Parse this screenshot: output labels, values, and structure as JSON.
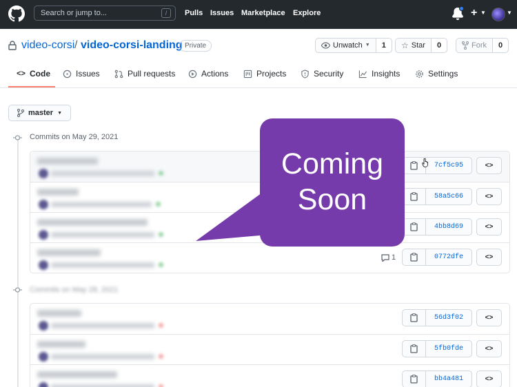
{
  "header": {
    "search_placeholder": "Search or jump to...",
    "search_shortcut": "/",
    "nav": [
      "Pulls",
      "Issues",
      "Marketplace",
      "Explore"
    ],
    "plus": "+"
  },
  "repo": {
    "owner": "video-corsi",
    "separator": "/",
    "name": "video-corsi-landing",
    "visibility": "Private",
    "watch": {
      "label": "Unwatch",
      "count": "1"
    },
    "star": {
      "label": "Star",
      "count": "0"
    },
    "fork": {
      "label": "Fork",
      "count": "0"
    }
  },
  "tabs": [
    {
      "label": "Code",
      "icon": "code-icon",
      "active": true
    },
    {
      "label": "Issues",
      "icon": "issue-icon"
    },
    {
      "label": "Pull requests",
      "icon": "pull-request-icon"
    },
    {
      "label": "Actions",
      "icon": "play-icon"
    },
    {
      "label": "Projects",
      "icon": "project-icon"
    },
    {
      "label": "Security",
      "icon": "shield-icon"
    },
    {
      "label": "Insights",
      "icon": "graph-icon"
    },
    {
      "label": "Settings",
      "icon": "gear-icon"
    }
  ],
  "branch": "master",
  "sections": [
    {
      "title": "Commits on May 29, 2021",
      "commits": [
        {
          "sha": "7cf5c95",
          "comments": ""
        },
        {
          "sha": "58a5c66",
          "comments": ""
        },
        {
          "sha": "4bb8d69",
          "comments": ""
        },
        {
          "sha": "0772dfe",
          "comments": "1"
        }
      ]
    },
    {
      "title": "Commits on May 28, 2021",
      "commits": [
        {
          "sha": "56d3f02",
          "comments": ""
        },
        {
          "sha": "5fb0fde",
          "comments": ""
        },
        {
          "sha": "bb4a481",
          "comments": ""
        }
      ]
    }
  ],
  "browse_label": "<>",
  "overlay": {
    "line1": "Coming",
    "line2": "Soon",
    "color": "#763bab"
  }
}
